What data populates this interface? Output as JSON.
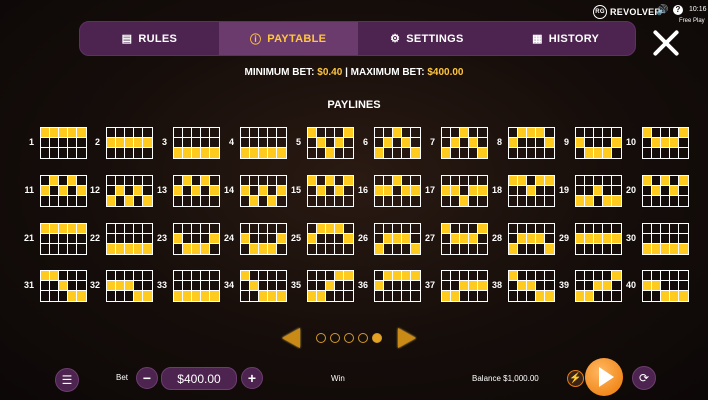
{
  "status": {
    "logo_badge": "RG",
    "logo_text": "REVOLVER",
    "sound_icon": "🔊",
    "help_icon": "?",
    "clock": "10:16",
    "mode": "Free Play"
  },
  "tabs": [
    {
      "label": "RULES",
      "icon": "rules-book-icon",
      "glyph": "▤"
    },
    {
      "label": "PAYTABLE",
      "icon": "info-icon",
      "glyph": "ⓘ"
    },
    {
      "label": "SETTINGS",
      "icon": "gear-icon",
      "glyph": "⚙"
    },
    {
      "label": "HISTORY",
      "icon": "calendar-icon",
      "glyph": "▦"
    }
  ],
  "active_tab": "PAYTABLE",
  "bet_info": {
    "min_label": "MINIMUM BET:",
    "min_value": "$0.40",
    "separator": "|",
    "max_label": "MAXIMUM BET:",
    "max_value": "$400.00"
  },
  "paylines_title": "PAYLINES",
  "highlight_color": "#ffcb1f",
  "paylines": [
    {
      "n": "1",
      "rows": [
        0,
        0,
        0,
        0,
        0
      ]
    },
    {
      "n": "2",
      "rows": [
        1,
        1,
        1,
        1,
        1
      ]
    },
    {
      "n": "3",
      "rows": [
        2,
        2,
        2,
        2,
        2
      ]
    },
    {
      "n": "4",
      "rows": [
        2,
        2,
        2,
        2,
        2
      ]
    },
    {
      "n": "5",
      "rows": [
        0,
        1,
        2,
        1,
        0
      ]
    },
    {
      "n": "6",
      "rows": [
        2,
        1,
        0,
        1,
        2
      ]
    },
    {
      "n": "7",
      "rows": [
        2,
        1,
        0,
        1,
        2
      ]
    },
    {
      "n": "8",
      "rows": [
        1,
        0,
        0,
        0,
        1
      ]
    },
    {
      "n": "9",
      "rows": [
        1,
        2,
        2,
        2,
        1
      ]
    },
    {
      "n": "10",
      "rows": [
        0,
        1,
        1,
        1,
        0
      ]
    },
    {
      "n": "11",
      "rows": [
        1,
        0,
        1,
        0,
        1
      ]
    },
    {
      "n": "12",
      "rows": [
        2,
        1,
        2,
        1,
        2
      ]
    },
    {
      "n": "13",
      "rows": [
        1,
        0,
        1,
        0,
        1
      ]
    },
    {
      "n": "14",
      "rows": [
        1,
        2,
        1,
        2,
        1
      ]
    },
    {
      "n": "15",
      "rows": [
        0,
        1,
        0,
        1,
        0
      ]
    },
    {
      "n": "16",
      "rows": [
        1,
        1,
        0,
        1,
        1
      ]
    },
    {
      "n": "17",
      "rows": [
        1,
        1,
        2,
        1,
        1
      ]
    },
    {
      "n": "18",
      "rows": [
        0,
        0,
        1,
        0,
        0
      ]
    },
    {
      "n": "19",
      "rows": [
        2,
        2,
        1,
        2,
        2
      ]
    },
    {
      "n": "20",
      "rows": [
        0,
        1,
        0,
        1,
        0
      ]
    },
    {
      "n": "21",
      "rows": [
        0,
        0,
        0,
        0,
        0
      ]
    },
    {
      "n": "22",
      "rows": [
        2,
        2,
        2,
        2,
        2
      ]
    },
    {
      "n": "23",
      "rows": [
        1,
        2,
        2,
        2,
        1
      ]
    },
    {
      "n": "24",
      "rows": [
        1,
        2,
        2,
        2,
        1
      ]
    },
    {
      "n": "25",
      "rows": [
        1,
        0,
        0,
        0,
        1
      ]
    },
    {
      "n": "26",
      "rows": [
        2,
        1,
        1,
        1,
        2
      ]
    },
    {
      "n": "27",
      "rows": [
        0,
        1,
        1,
        1,
        0
      ]
    },
    {
      "n": "28",
      "rows": [
        2,
        1,
        1,
        1,
        2
      ]
    },
    {
      "n": "29",
      "rows": [
        1,
        1,
        1,
        1,
        1
      ]
    },
    {
      "n": "30",
      "rows": [
        2,
        2,
        2,
        2,
        2
      ]
    },
    {
      "n": "31",
      "rows": [
        0,
        0,
        1,
        2,
        2
      ]
    },
    {
      "n": "32",
      "rows": [
        1,
        1,
        1,
        2,
        2
      ]
    },
    {
      "n": "33",
      "rows": [
        2,
        2,
        2,
        2,
        2
      ]
    },
    {
      "n": "34",
      "rows": [
        0,
        1,
        2,
        2,
        2
      ]
    },
    {
      "n": "35",
      "rows": [
        2,
        2,
        1,
        0,
        0
      ]
    },
    {
      "n": "36",
      "rows": [
        1,
        0,
        0,
        0,
        0
      ]
    },
    {
      "n": "37",
      "rows": [
        2,
        2,
        1,
        1,
        1
      ]
    },
    {
      "n": "38",
      "rows": [
        0,
        1,
        1,
        2,
        2
      ]
    },
    {
      "n": "39",
      "rows": [
        2,
        2,
        1,
        1,
        0
      ]
    },
    {
      "n": "40",
      "rows": [
        1,
        1,
        2,
        2,
        2
      ]
    }
  ],
  "pager": {
    "pages": 5,
    "active": 5
  },
  "bottom": {
    "menu_icon": "☰",
    "bet_label": "Bet",
    "minus": "−",
    "bet_value": "$400.00",
    "plus": "+",
    "win_label": "Win",
    "balance_label": "Balance $1,000.00",
    "turbo_icon": "⚡",
    "autoplay_icon": "⟳"
  }
}
